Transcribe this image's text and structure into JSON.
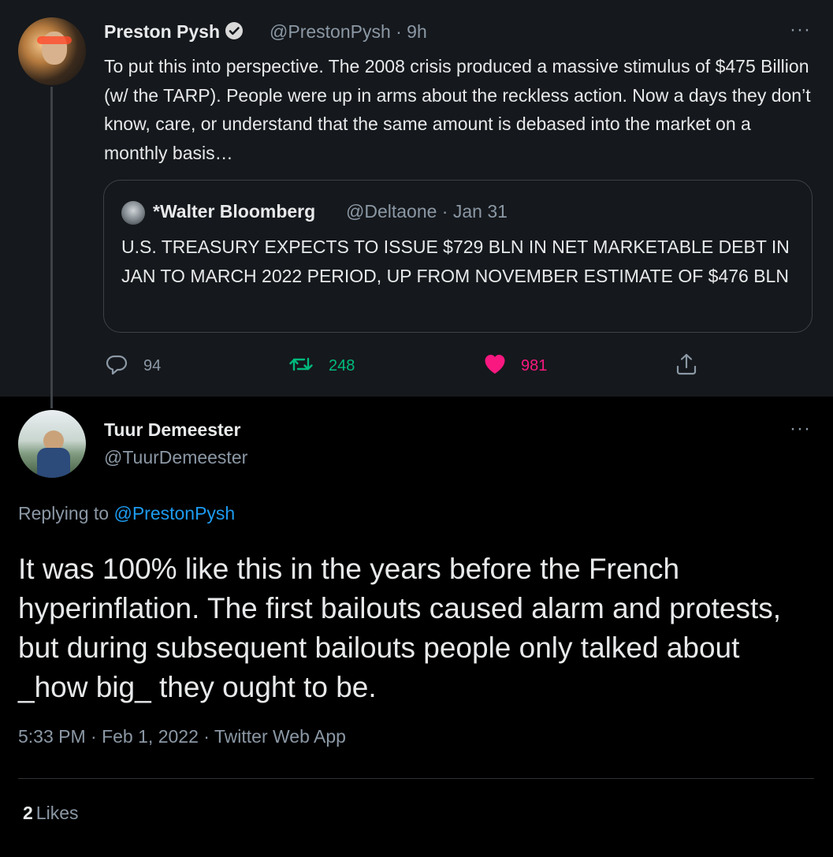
{
  "parent_tweet": {
    "author_name": "Preston Pysh",
    "handle_time": "@PrestonPysh · 9h",
    "more": "···",
    "text": "To put this into perspective.  The 2008 crisis produced a massive stimulus of $475 Billion (w/ the TARP).  People were up in arms about the reckless action.  Now a days they don’t know, care, or understand that the same amount is debased into the market on a monthly basis…",
    "quoted": {
      "author_name": "*Walter Bloomberg",
      "handle_time": "@Deltaone · Jan 31",
      "text": "U.S. TREASURY EXPECTS TO ISSUE $729 BLN IN NET MARKETABLE DEBT IN JAN TO MARCH 2022 PERIOD, UP FROM NOVEMBER ESTIMATE OF $476 BLN"
    },
    "replies": "94",
    "retweets": "248",
    "likes": "981"
  },
  "main_tweet": {
    "author_name": "Tuur Demeester",
    "handle": "@TuurDemeester",
    "more": "···",
    "replying_to_label": "Replying to ",
    "replying_to_handle": "@PrestonPysh",
    "text": "It was 100% like this in the years before the French hyperinflation. The first bailouts caused alarm and protests, but during subsequent bailouts people only talked about _how big_ they ought to be.",
    "meta": "5:33 PM · Feb 1, 2022 · Twitter Web App",
    "likes_count": "2",
    "likes_label": "Likes"
  },
  "icons": {
    "verified": "verified-badge-icon",
    "reply": "reply-icon",
    "retweet": "retweet-icon",
    "like": "heart-icon",
    "share": "share-icon"
  },
  "colors": {
    "background_top": "#15181c",
    "background_main": "#000000",
    "text_secondary": "#8b98a5",
    "retweet": "#00ba7c",
    "like": "#f91880",
    "link": "#1d9bf0"
  }
}
